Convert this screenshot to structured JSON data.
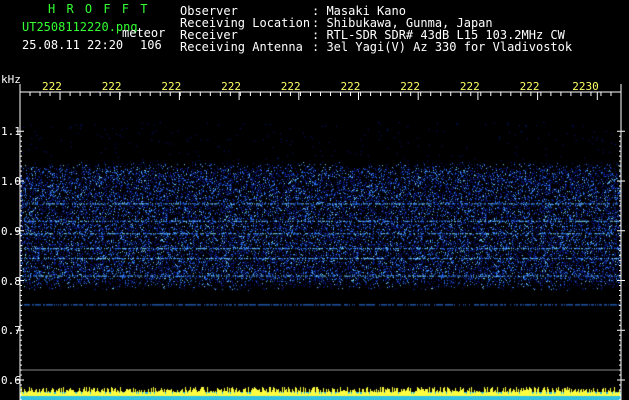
{
  "header": {
    "app_name": "H R O F F T",
    "filename": "UT2508112220.png",
    "mode": "meteor",
    "datetime": "25.08.11 22:20",
    "count": "106",
    "fields": [
      {
        "label": "Observer",
        "value": ": Masaki Kano"
      },
      {
        "label": "Receiving Location",
        "value": ": Shibukawa, Gunma, Japan"
      },
      {
        "label": "Receiver",
        "value": ": RTL-SDR SDR# 43dB L15 103.2MHz CW"
      },
      {
        "label": "Receiving Antenna",
        "value": ": 3el Yagi(V) Az 330 for Vladivostok"
      }
    ]
  },
  "chart_data": {
    "type": "heatmap",
    "ylabel": "kHz",
    "y_ticks": [
      "1.1",
      "1.0",
      "0.9",
      "0.8",
      "0.7",
      "0.6"
    ],
    "x_ticks": [
      "222",
      "222",
      "222",
      "222",
      "222",
      "222",
      "222",
      "222",
      "222",
      "2230"
    ],
    "ylim": [
      0.6,
      1.15
    ],
    "colors": {
      "background": "#000000",
      "low": "#0a1a8c",
      "mid": "#2f7fff",
      "high": "#80e0ff",
      "peak": "#ffff40",
      "axis": "#ffffff",
      "ticklabel": "#ffff66"
    }
  }
}
